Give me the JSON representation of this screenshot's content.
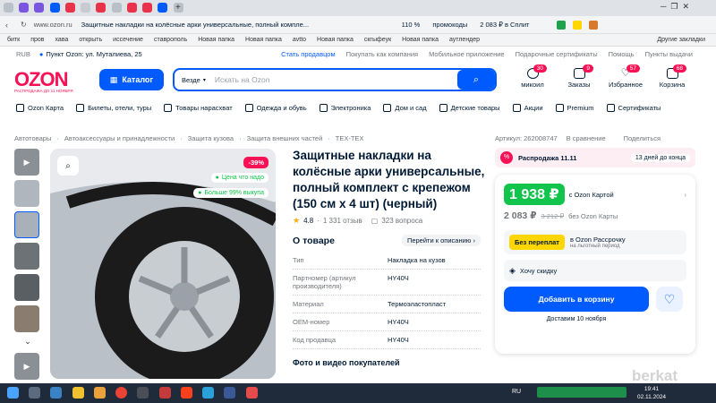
{
  "browser": {
    "tab_title": "Защитные накладки на колёсные арки универсальные, полный компле...",
    "url_domain": "www.ozon.ru",
    "zoom": "110 %",
    "promo_chip": "промокоды",
    "split_chip": "2 083 ₽ в Сплит",
    "bookmarks": [
      "битк",
      "пров",
      "хава",
      "открыть",
      "иссечение",
      "ставрополь",
      "Новая папка",
      "Новая папка",
      "avtto",
      "Новая папка",
      "скгыфеук",
      "Новая папка",
      "аутлендер"
    ],
    "other_bookmarks": "Другие закладки"
  },
  "topline": {
    "currency": "RUB",
    "pickup": "Пункт Ozon: ул. Муталиева, 25",
    "links": [
      "Стать продавцом",
      "Покупать как компания",
      "Мобильное приложение",
      "Подарочные сертификаты",
      "Помощь",
      "Пункты выдачи"
    ]
  },
  "header": {
    "logo": "OZON",
    "logo_sub": "РАСПРОДАЖА ДО 11 НОЯБРЯ",
    "catalog": "Каталог",
    "search_scope": "Везде",
    "search_placeholder": "Искать на Ozon",
    "icons": [
      {
        "label": "микоил",
        "badge": "30",
        "icon": "smile-icon"
      },
      {
        "label": "Заказы",
        "badge": "9",
        "icon": "box-icon"
      },
      {
        "label": "Избранное",
        "badge": "57",
        "icon": "heart-icon"
      },
      {
        "label": "Корзина",
        "badge": "68",
        "icon": "cart-icon"
      }
    ]
  },
  "catnav": [
    "Ozon Карта",
    "Билеты, отели, туры",
    "Товары нарасхват",
    "Одежда и обувь",
    "Электроника",
    "Дом и сад",
    "Детские товары",
    "Акции",
    "Premium",
    "Сертификаты"
  ],
  "product": {
    "breadcrumbs": [
      "Автотовары",
      "Автоаксессуары и принадлежности",
      "Защита кузова",
      "Защита внешних частей",
      "TEX-TEX"
    ],
    "article": "Артикул: 262008747",
    "compare": "В сравнение",
    "share": "Поделиться",
    "discount": "-39%",
    "price_good": "Цена что надо",
    "buyout": "Больше 99% выкупа",
    "title": "Защитные накладки на колёсные арки универсальные, полный комплект с крепежом (150 см х 4 шт) (черный)",
    "rating": "4.8",
    "reviews": "1 331 отзыв",
    "questions": "323 вопроса",
    "about_title": "О товаре",
    "go_desc": "Перейти к описанию",
    "specs": [
      {
        "k": "Тип",
        "v": "Накладка на кузов"
      },
      {
        "k": "Партномер (артикул производителя)",
        "v": "HY40Ч"
      },
      {
        "k": "Материал",
        "v": "Термоэластопласт"
      },
      {
        "k": "OEM-номер",
        "v": "HY40Ч"
      },
      {
        "k": "Код продавца",
        "v": "HY40Ч"
      }
    ],
    "photos_more": "Фото и видео покупателей"
  },
  "buybox": {
    "sale": "Распродажа 11.11",
    "sale_days": "13 дней до конца",
    "card_price": "1 938 ₽",
    "card_label": "c Ozon Картой",
    "price": "2 083 ₽",
    "old_price": "3 212 ₽",
    "no_card": "без Ozon Карты",
    "overpay_badge": "Без переплат",
    "installment": "в Ozon Рассрочку",
    "installment_sub": "на льготный период",
    "want_discount": "Хочу скидку",
    "add_to_cart": "Добавить в корзину",
    "delivery": "Доставим 10 ноября"
  },
  "taskbar": {
    "lang": "RU",
    "time": "19:41",
    "date": "02.11.2024",
    "watermark": "berkat"
  }
}
